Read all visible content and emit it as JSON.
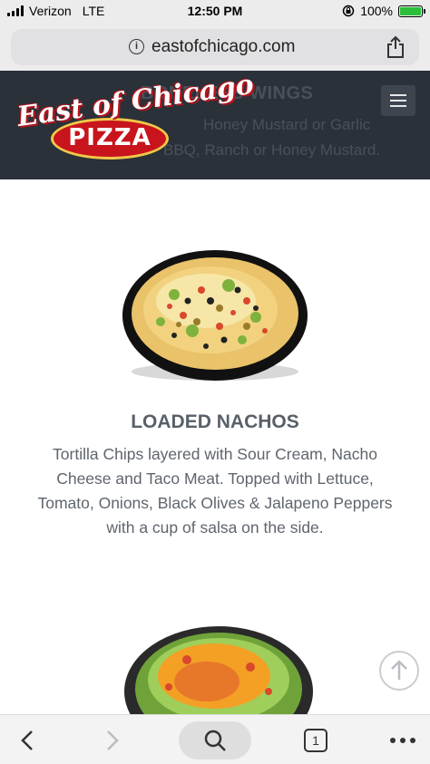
{
  "status_bar": {
    "carrier": "Verizon",
    "network": "LTE",
    "time": "12:50 PM",
    "watermark": "",
    "battery": "100%",
    "battery_level": 1.0,
    "icons": [
      "signal-icon",
      "orientation-lock-icon",
      "battery-icon"
    ]
  },
  "browser": {
    "url": "eastofchicago.com",
    "icons": [
      "info-icon",
      "share-icon"
    ]
  },
  "site_header": {
    "logo_script": "East of Chicago",
    "logo_word": "PIZZA",
    "ghost_title": "BONELESS WINGS",
    "ghost_line_1": "Honey Mustard or Garlic",
    "ghost_line_2": "BBQ, Ranch or Honey Mustard.",
    "menu_icon": "hamburger-menu-icon"
  },
  "menu_item": {
    "title": "LOADED NACHOS",
    "description": "Tortilla Chips layered with Sour Cream, Nacho Cheese and Taco Meat. Topped with Lettuce, Tomato, Onions, Black Olives & Jalapeno Peppers with a cup of salsa on the side."
  },
  "toolbar": {
    "tab_count": "1",
    "icons": [
      "back-icon",
      "forward-icon",
      "search-icon",
      "tabs-icon",
      "more-icon"
    ]
  },
  "colors": {
    "header_bg": "#2b3139",
    "brand_red": "#c8141c",
    "title_text": "#59606a"
  }
}
